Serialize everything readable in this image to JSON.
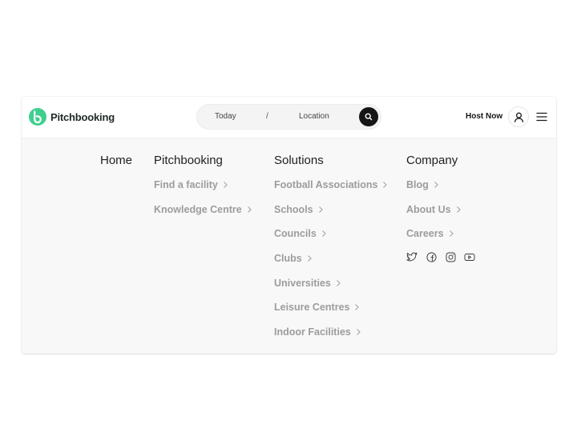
{
  "brand": {
    "name": "Pitchbooking",
    "accent": "#3ecf8e"
  },
  "search": {
    "date_label": "Today",
    "separator": "/",
    "location_label": "Location",
    "button_icon": "search-icon"
  },
  "header": {
    "host_label": "Host Now",
    "user_icon": "user-icon",
    "menu_icon": "hamburger-icon"
  },
  "nav": {
    "home": {
      "title": "Home"
    },
    "pitchbooking": {
      "title": "Pitchbooking",
      "links": [
        {
          "label": "Find a facility"
        },
        {
          "label": "Knowledge Centre"
        }
      ]
    },
    "solutions": {
      "title": "Solutions",
      "links": [
        {
          "label": "Football Associations"
        },
        {
          "label": "Schools"
        },
        {
          "label": "Councils"
        },
        {
          "label": "Clubs"
        },
        {
          "label": "Universities"
        },
        {
          "label": "Leisure Centres"
        },
        {
          "label": "Indoor Facilities"
        }
      ]
    },
    "company": {
      "title": "Company",
      "links": [
        {
          "label": "Blog"
        },
        {
          "label": "About Us"
        },
        {
          "label": "Careers"
        }
      ],
      "social": [
        "twitter-icon",
        "facebook-icon",
        "instagram-icon",
        "youtube-icon"
      ]
    }
  }
}
